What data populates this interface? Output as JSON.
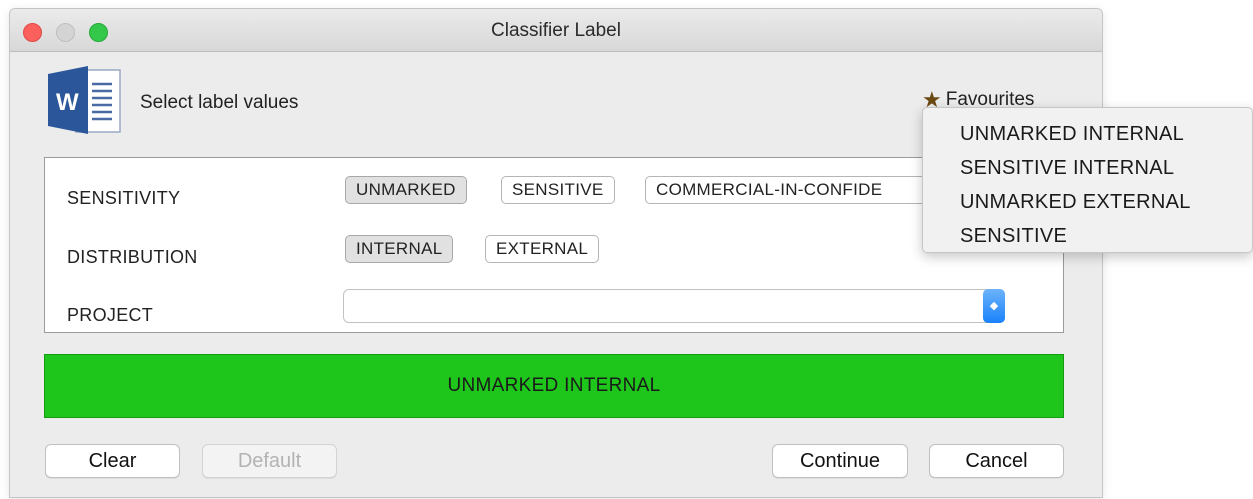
{
  "window": {
    "title": "Classifier Label"
  },
  "header": {
    "select_label": "Select label values",
    "favourites_label": "Favourites",
    "app_icon": "word-icon"
  },
  "fields": {
    "sensitivity": {
      "label": "SENSITIVITY",
      "options": [
        "UNMARKED",
        "SENSITIVE",
        "COMMERCIAL-IN-CONFIDE"
      ],
      "selected": "UNMARKED"
    },
    "distribution": {
      "label": "DISTRIBUTION",
      "options": [
        "INTERNAL",
        "EXTERNAL"
      ],
      "selected": "INTERNAL"
    },
    "project": {
      "label": "PROJECT",
      "value": ""
    }
  },
  "banner": {
    "text": "UNMARKED INTERNAL",
    "color": "#1ec51b"
  },
  "buttons": {
    "clear": "Clear",
    "default": "Default",
    "continue": "Continue",
    "cancel": "Cancel"
  },
  "favourites_menu": {
    "items": [
      "UNMARKED INTERNAL",
      "SENSITIVE INTERNAL",
      "UNMARKED EXTERNAL",
      "SENSITIVE"
    ]
  }
}
